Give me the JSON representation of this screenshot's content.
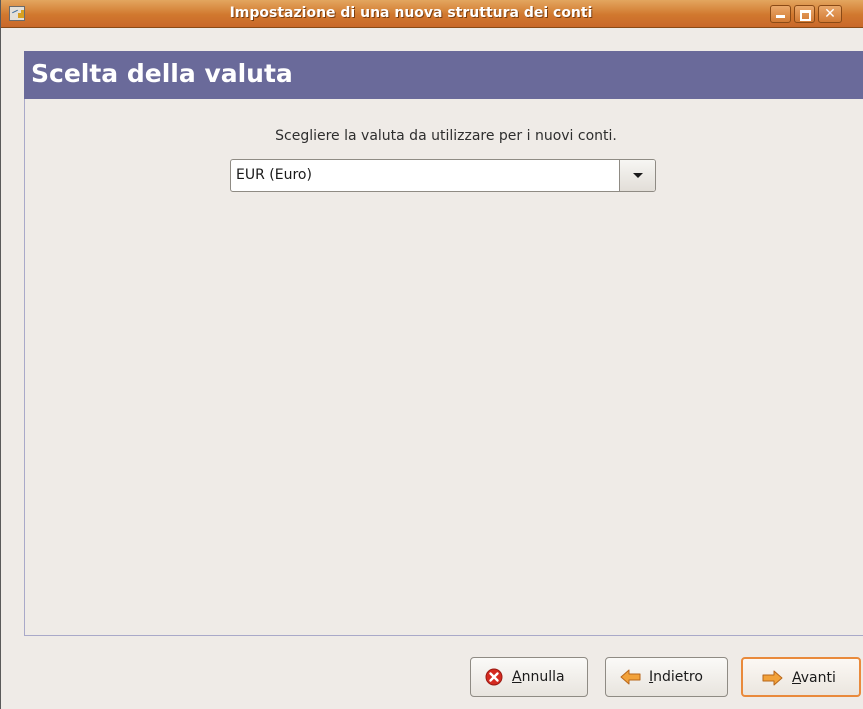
{
  "window": {
    "title": "Impostazione di una nuova struttura dei conti"
  },
  "header": {
    "title": "Scelta della valuta"
  },
  "content": {
    "instruction": "Scegliere la valuta da utilizzare per i nuovi conti.",
    "currency_select": {
      "selected": "EUR (Euro)"
    }
  },
  "buttons": {
    "cancel": {
      "mnemonic": "A",
      "rest": "nnulla"
    },
    "back": {
      "mnemonic": "I",
      "rest": "ndietro"
    },
    "next": {
      "mnemonic": "A",
      "rest": "vanti"
    }
  },
  "colors": {
    "titlebar": "#d1782e",
    "header_bg": "#6a6a9a",
    "default_button_border": "#e98a3c",
    "cancel_icon": "#d42a20",
    "arrow_icon": "#f2a23a"
  },
  "icons": {
    "app": "gnucash-app-icon",
    "cancel": "cancel-x-icon",
    "back": "arrow-left-icon",
    "next": "arrow-right-icon",
    "dropdown": "chevron-down-icon"
  }
}
